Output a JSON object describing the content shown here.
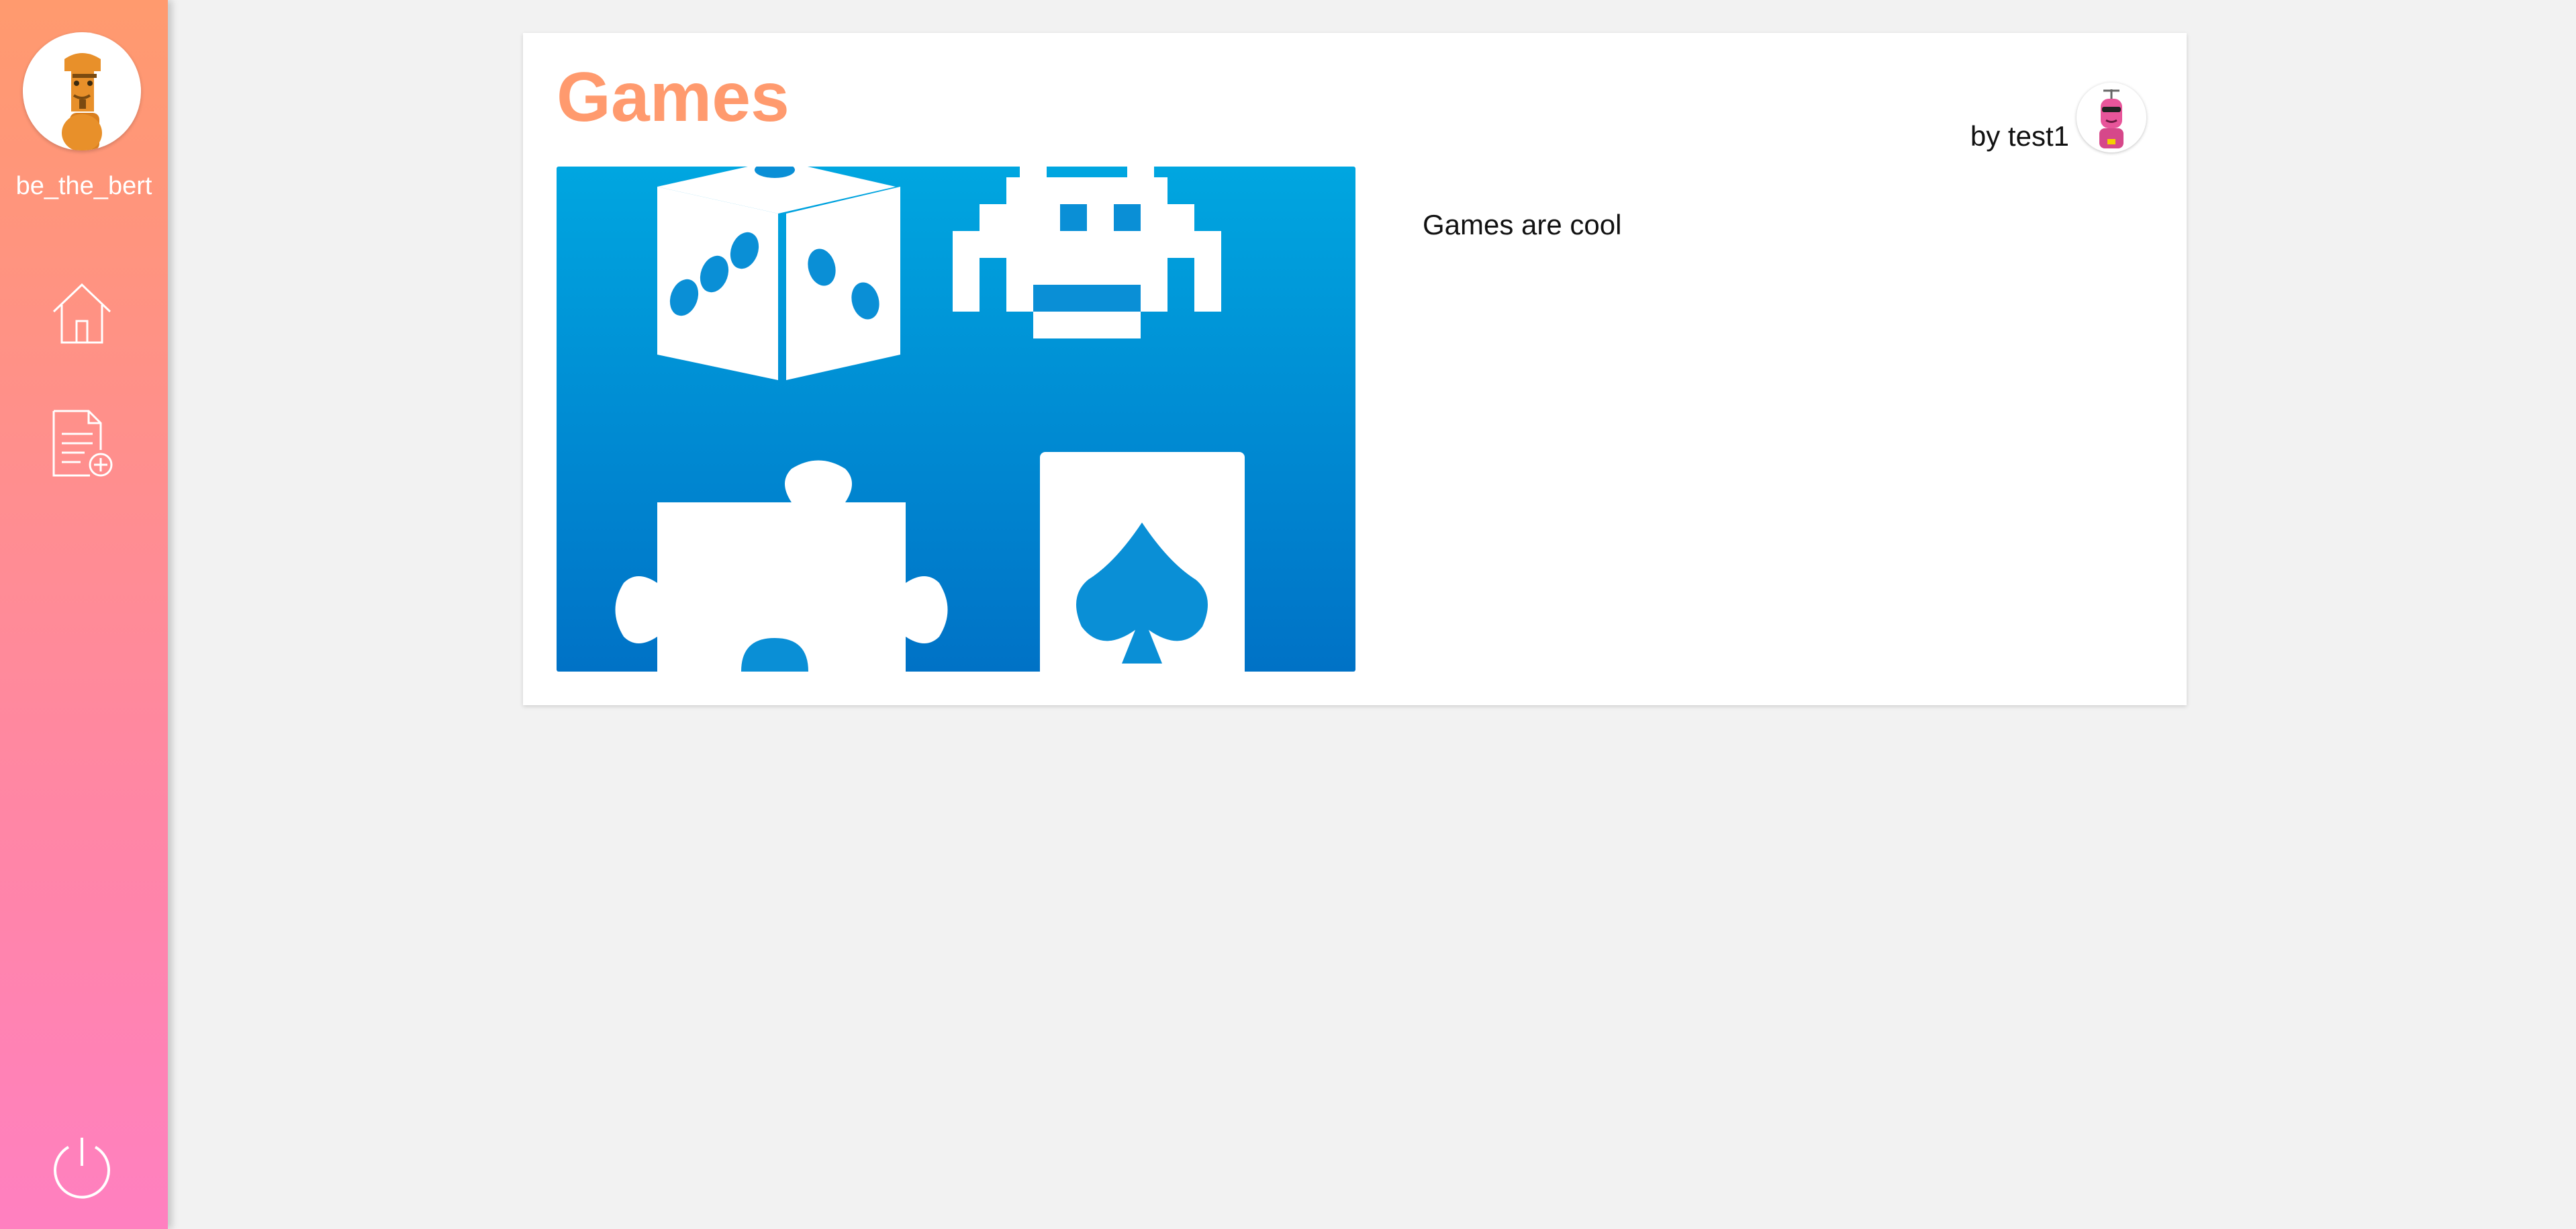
{
  "sidebar": {
    "username": "be_the_bert",
    "avatar_icon": "robot-avatar-icon",
    "nav": [
      {
        "icon": "home-icon"
      },
      {
        "icon": "new-post-icon"
      }
    ],
    "logout_icon": "power-icon",
    "gradient": [
      "#ff9a6e",
      "#ff80c0"
    ]
  },
  "post": {
    "title": "Games",
    "author": "by test1",
    "body": "Games are cool",
    "image_icon": "games-image",
    "accent_color": "#ff9a6e",
    "image_color": "#0077cc"
  }
}
